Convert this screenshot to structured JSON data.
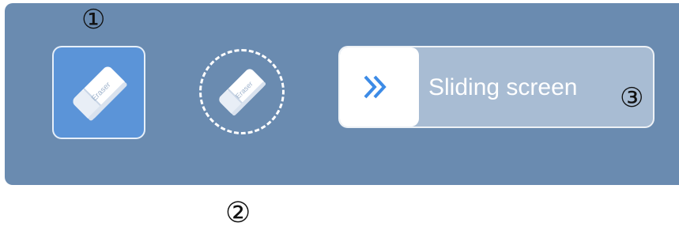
{
  "markers": {
    "m1": "①",
    "m2": "②",
    "m3": "③"
  },
  "eraser_button": {
    "icon": "eraser-icon",
    "text": "Eraser"
  },
  "eraser_drag": {
    "icon": "eraser-icon",
    "text": "Eraser"
  },
  "slider": {
    "label": "Sliding screen",
    "icon": "double-chevron-right-icon"
  },
  "colors": {
    "panel": "#6a8bb0",
    "button_active": "#5b94d8",
    "slider_track": "#a8bcd3",
    "chevron": "#3d8be6"
  }
}
